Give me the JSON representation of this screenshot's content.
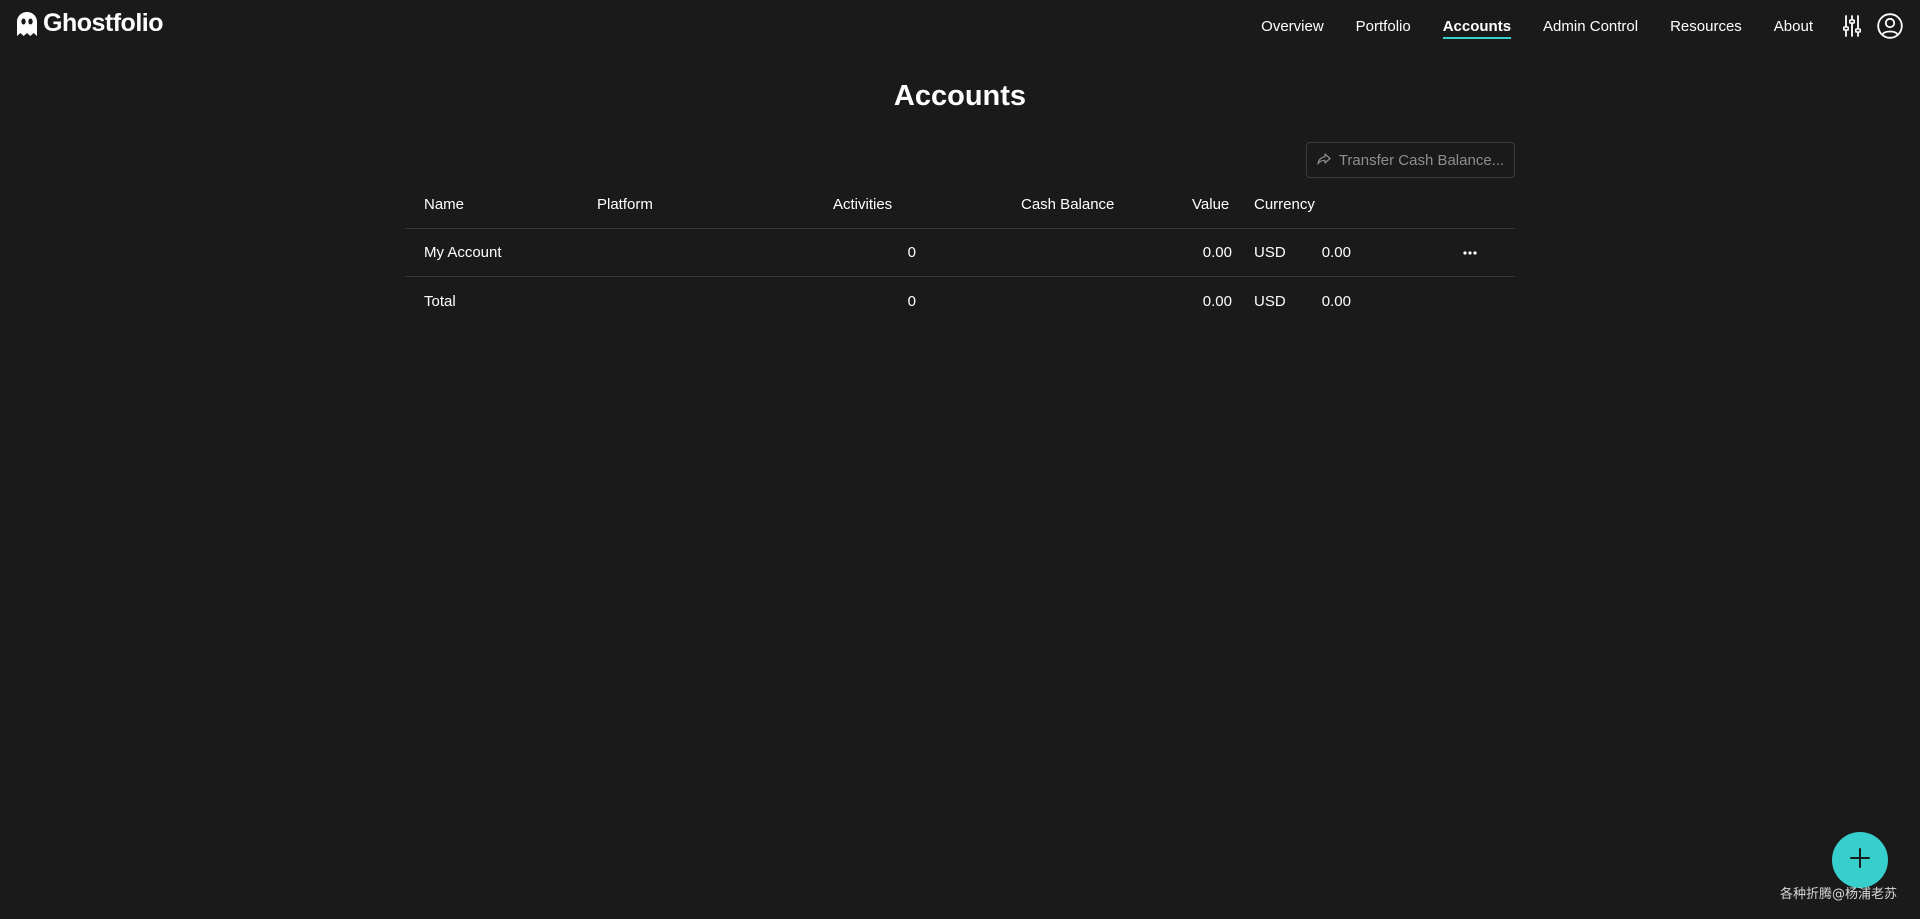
{
  "app": {
    "brand": "Ghostfolio",
    "accent_color": "#36cfcc",
    "background_color": "#1a1a1a"
  },
  "nav": {
    "items": [
      {
        "label": "Overview",
        "active": false
      },
      {
        "label": "Portfolio",
        "active": false
      },
      {
        "label": "Accounts",
        "active": true
      },
      {
        "label": "Admin Control",
        "active": false
      },
      {
        "label": "Resources",
        "active": false
      },
      {
        "label": "About",
        "active": false
      }
    ],
    "icons": [
      "settings-sliders-icon",
      "user-circle-icon"
    ]
  },
  "page": {
    "title": "Accounts",
    "transfer_button_label": "Transfer Cash Balance..."
  },
  "table": {
    "headers": {
      "name": "Name",
      "platform": "Platform",
      "activities": "Activities",
      "cash_balance": "Cash Balance",
      "value": "Value",
      "currency": "Currency"
    },
    "rows": [
      {
        "name": "My Account",
        "platform": "",
        "activities": "0",
        "cash_balance": "0.00",
        "value": "0.00",
        "currency": "USD",
        "menu_icon": "more-horizontal-icon"
      }
    ],
    "total": {
      "name": "Total",
      "activities": "0",
      "cash_balance": "0.00",
      "value": "0.00",
      "currency": "USD"
    }
  },
  "fab": {
    "icon": "plus-icon"
  },
  "watermark": "各种折腾@杨浦老苏"
}
